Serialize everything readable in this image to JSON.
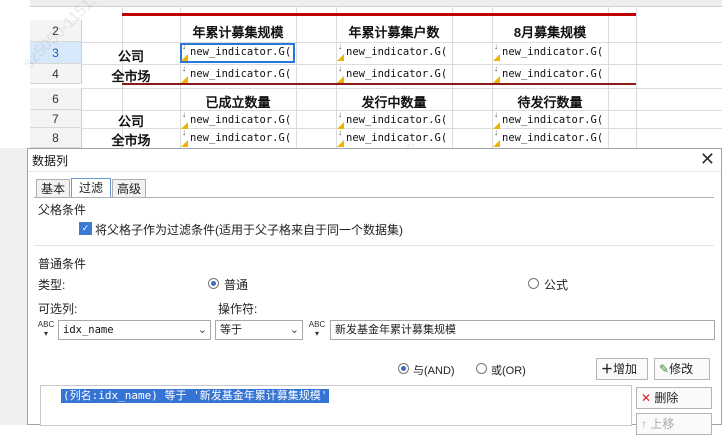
{
  "sheet": {
    "rows": [
      "2",
      "3",
      "4",
      "6",
      "7",
      "8"
    ],
    "headers_top": [
      "年累计募集规模",
      "年累计募集户数",
      "8月募集规模"
    ],
    "headers_bottom": [
      "已成立数量",
      "发行中数量",
      "待发行数量"
    ],
    "labels": [
      "公司",
      "全市场",
      "公司",
      "全市场"
    ],
    "cell_value": "new_indicator.G(",
    "cell_arrow": "↓"
  },
  "watermark": "sz5050-1151, 2021-09-02 18:32",
  "dialog": {
    "title": "数据列",
    "close": "✕",
    "tabs": [
      "基本",
      "过滤",
      "高级"
    ],
    "parent_section": "父格条件",
    "parent_checkbox": "将父格子作为过滤条件(适用于父子格来自于同一个数据集)",
    "common_section": "普通条件",
    "type_label": "类型:",
    "type_options": [
      "普通",
      "公式"
    ],
    "optional_col_label": "可选列:",
    "operator_label": "操作符:",
    "column_value": "idx_name",
    "operator_value": "等于",
    "value_text": "新发基金年累计募集规模",
    "abc_icon": "ABC",
    "and_label": "与(AND)",
    "or_label": "或(OR)",
    "add_button": "增加",
    "modify_button": "修改",
    "delete_button": "删除",
    "up_button": "上移",
    "condition_item": "(列名:idx_name) 等于 '新发基金年累计募集规模'"
  }
}
